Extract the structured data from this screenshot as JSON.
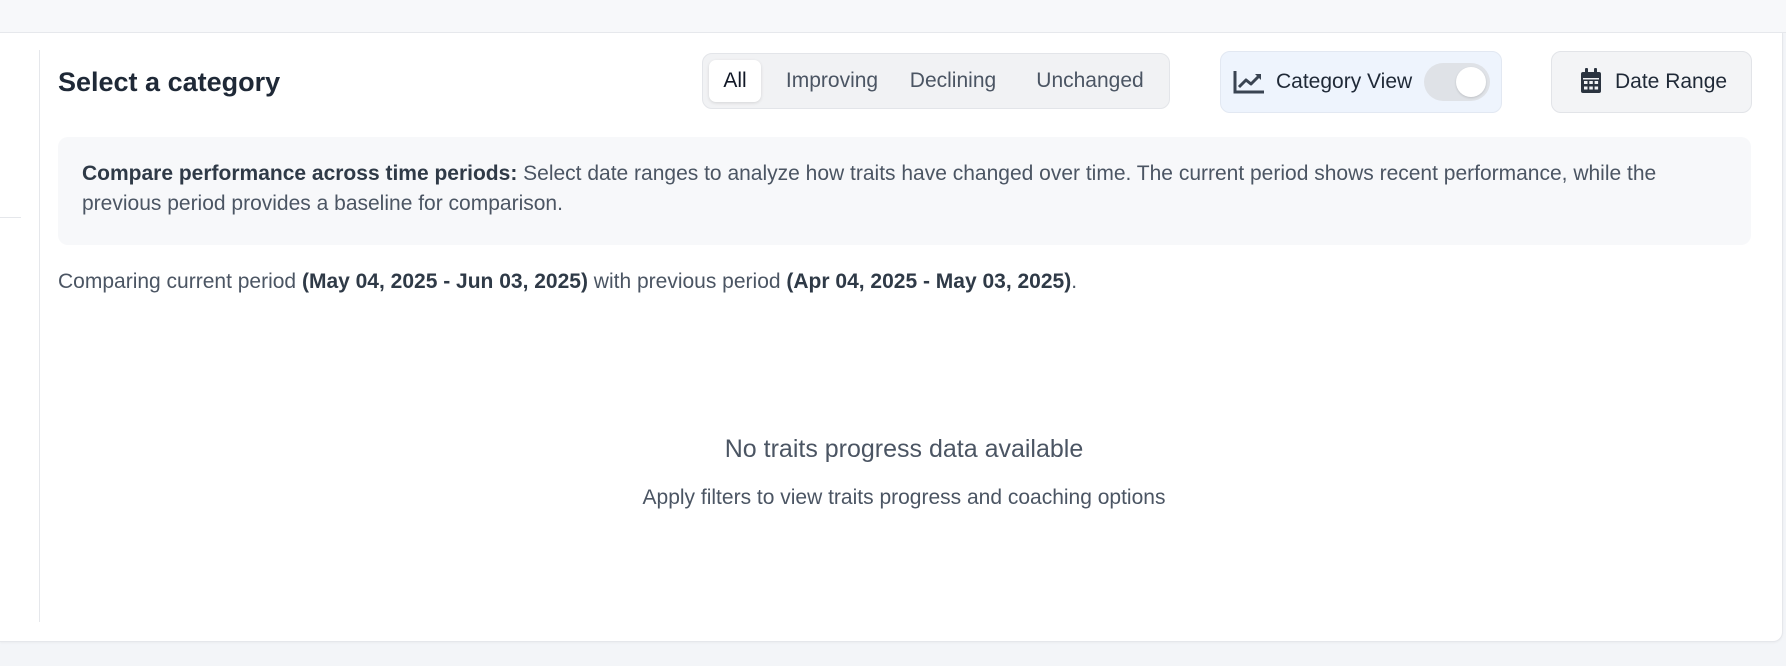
{
  "header": {
    "title": "Select a category"
  },
  "filters": {
    "tabs": [
      {
        "label": "All",
        "active": true
      },
      {
        "label": "Improving",
        "active": false
      },
      {
        "label": "Declining",
        "active": false
      },
      {
        "label": "Unchanged",
        "active": false
      }
    ]
  },
  "category_view": {
    "label": "Category View",
    "icon": "chart-line-icon",
    "toggle_on": false
  },
  "date_range": {
    "label": "Date Range",
    "icon": "calendar-icon"
  },
  "info": {
    "lead": "Compare performance across time periods:",
    "text": " Select date ranges to analyze how traits have changed over time. The current period shows recent performance, while the previous period provides a baseline for comparison."
  },
  "comparison": {
    "prefix": "Comparing current period ",
    "current_period": "(May 04, 2025 - Jun 03, 2025)",
    "middle": " with previous period ",
    "previous_period": "(Apr 04, 2025 - May 03, 2025)",
    "suffix": "."
  },
  "empty_state": {
    "title": "No traits progress data available",
    "subtitle": "Apply filters to view traits progress and coaching options"
  },
  "colors": {
    "accent_panel": "#eef4fd",
    "text": "#1f2937"
  }
}
